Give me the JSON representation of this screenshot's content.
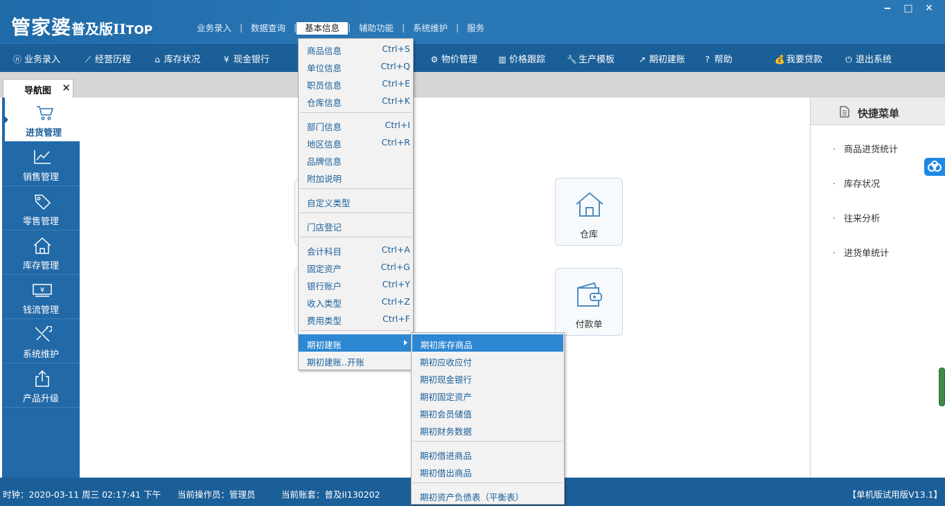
{
  "app": {
    "logo_main": "管家婆",
    "logo_edition": "普及版II",
    "logo_top": "TOP"
  },
  "top_menu": [
    "业务录入",
    "数据查询",
    "基本信息",
    "辅助功能",
    "系统维护",
    "服务"
  ],
  "window_buttons": {
    "minimize": "‒",
    "maximize": "□",
    "close": "✕"
  },
  "toolbar": [
    {
      "label": "业务录入",
      "icon": "ⓝ"
    },
    {
      "label": "经营历程",
      "icon": "⟋"
    },
    {
      "label": "库存状况",
      "icon": "⌂"
    },
    {
      "label": "现金银行",
      "icon": "¥"
    },
    {
      "label": "物价管理",
      "icon": "⚙"
    },
    {
      "label": "价格跟踪",
      "icon": "▥"
    },
    {
      "label": "生产模板",
      "icon": "🔧"
    },
    {
      "label": "期初建账",
      "icon": "↗"
    },
    {
      "label": "帮助",
      "icon": "?"
    },
    {
      "label": "我要贷款",
      "icon": "💰"
    },
    {
      "label": "退出系统",
      "icon": "⏻"
    }
  ],
  "tab": {
    "label": "导航图",
    "close": "✕"
  },
  "sidebar": [
    {
      "label": "进货管理",
      "icon": "cart-icon",
      "active": true
    },
    {
      "label": "销售管理",
      "icon": "chart-icon"
    },
    {
      "label": "零售管理",
      "icon": "tag-icon"
    },
    {
      "label": "库存管理",
      "icon": "house-icon"
    },
    {
      "label": "钱流管理",
      "icon": "money-icon"
    },
    {
      "label": "系统维护",
      "icon": "tools-icon"
    },
    {
      "label": "产品升级",
      "icon": "upload-icon"
    }
  ],
  "cards": [
    {
      "label": "仓库",
      "icon": "warehouse-icon"
    },
    {
      "label": "付款单",
      "icon": "wallet-icon"
    }
  ],
  "quick_menu": {
    "title": "快捷菜单",
    "items": [
      "商品进货统计",
      "库存状况",
      "往来分析",
      "进货单统计"
    ]
  },
  "basic_info_menu": [
    {
      "label": "商品信息",
      "shortcut": "Ctrl+S"
    },
    {
      "label": "单位信息",
      "shortcut": "Ctrl+Q"
    },
    {
      "label": "职员信息",
      "shortcut": "Ctrl+E"
    },
    {
      "label": "仓库信息",
      "shortcut": "Ctrl+K"
    },
    {
      "label": "部门信息",
      "shortcut": "Ctrl+I"
    },
    {
      "label": "地区信息",
      "shortcut": "Ctrl+R"
    },
    {
      "label": "品牌信息",
      "shortcut": ""
    },
    {
      "label": "附加说明",
      "shortcut": ""
    },
    {
      "label": "自定义类型",
      "shortcut": ""
    },
    {
      "label": "门店登记",
      "shortcut": ""
    },
    {
      "label": "会计科目",
      "shortcut": "Ctrl+A"
    },
    {
      "label": "固定资产",
      "shortcut": "Ctrl+G"
    },
    {
      "label": "银行账户",
      "shortcut": "Ctrl+Y"
    },
    {
      "label": "收入类型",
      "shortcut": "Ctrl+Z"
    },
    {
      "label": "费用类型",
      "shortcut": "Ctrl+F"
    },
    {
      "label": "期初建账",
      "shortcut": ""
    },
    {
      "label": "期初建账..开账",
      "shortcut": ""
    }
  ],
  "opening_submenu": [
    "期初库存商品",
    "期初应收应付",
    "期初现金银行",
    "期初固定资产",
    "期初会员储值",
    "期初财务数据",
    "期初借进商品",
    "期初借出商品",
    "期初资产负债表（平衡表）"
  ],
  "status": {
    "clock": "时钟：2020-03-11 周三 02:17:41 下午",
    "operator": "当前操作员：管理员",
    "account": "当前账套：普及II130202",
    "version": "【单机版试用版V13.1】"
  }
}
